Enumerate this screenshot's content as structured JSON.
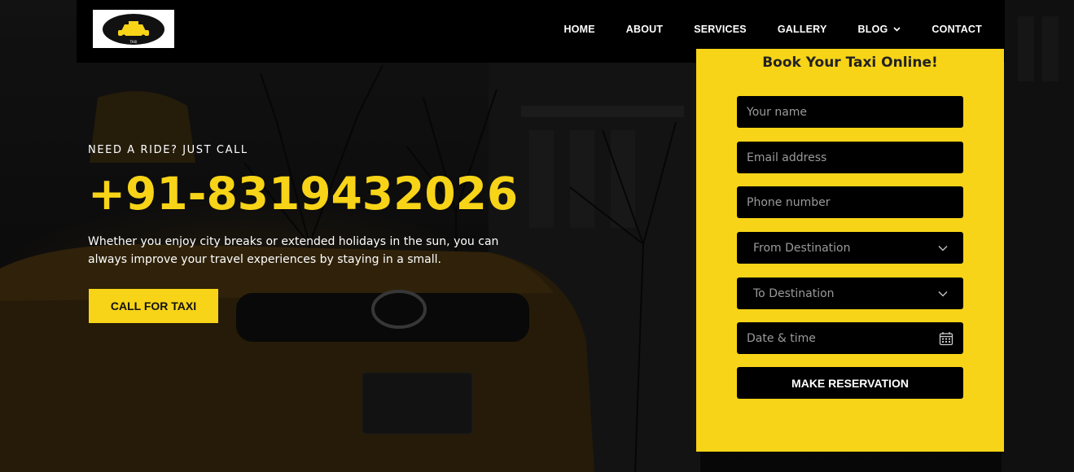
{
  "brand": {
    "logo_icon": "taxi-logo-icon",
    "logo_text": "TAXI"
  },
  "nav": {
    "items": [
      {
        "label": "HOME"
      },
      {
        "label": "ABOUT"
      },
      {
        "label": "SERVICES"
      },
      {
        "label": "GALLERY"
      },
      {
        "label": "BLOG",
        "has_dropdown": true
      },
      {
        "label": "CONTACT"
      }
    ]
  },
  "hero": {
    "eyebrow": "NEED A RIDE? JUST CALL",
    "phone": "+91-8319432026",
    "description": "Whether you enjoy city breaks or extended holidays in the sun, you can always improve your travel experiences by staying in a small.",
    "cta_label": "CALL FOR TAXI"
  },
  "booking": {
    "title": "Book Your Taxi Online!",
    "name_placeholder": "Your name",
    "email_placeholder": "Email address",
    "phone_placeholder": "Phone number",
    "from_label": "From Destination",
    "to_label": "To Destination",
    "datetime_placeholder": "Date & time",
    "submit_label": "MAKE RESERVATION"
  },
  "colors": {
    "accent": "#f7d417",
    "dark": "#000000",
    "text_light": "#ffffff"
  }
}
